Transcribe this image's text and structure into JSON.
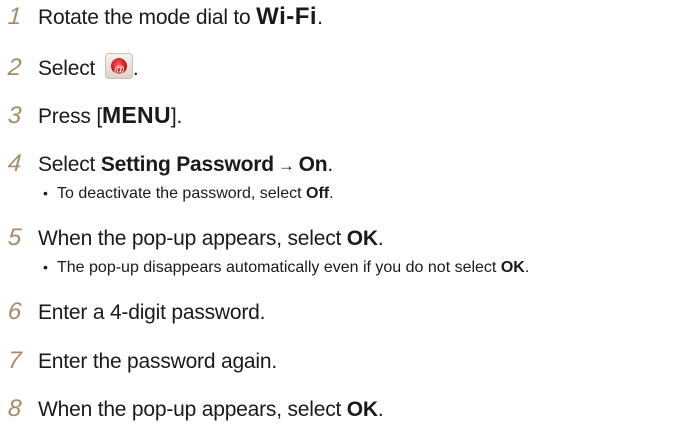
{
  "steps": [
    {
      "num": "1",
      "text": "Rotate the mode dial to ",
      "mode_label": "Wi-Fi",
      "end": "."
    },
    {
      "num": "2",
      "text": "Select ",
      "icon": "wifi-app-icon",
      "end": "."
    },
    {
      "num": "3",
      "text": "Press [",
      "key_label": "MENU",
      "end": "]."
    },
    {
      "num": "4",
      "text": "Select ",
      "bold1": "Setting Password",
      "arrow": "→",
      "bold2": "On",
      "end": "."
    },
    {
      "num": "5",
      "text": "When the pop-up appears, select ",
      "bold": "OK",
      "end": "."
    },
    {
      "num": "6",
      "text": "Enter a 4-digit password."
    },
    {
      "num": "7",
      "text": "Enter the password again."
    },
    {
      "num": "8",
      "text": "When the pop-up appears, select ",
      "bold": "OK",
      "end": "."
    }
  ],
  "subs": [
    {
      "bullet": "•",
      "text": "To deactivate the password, select ",
      "bold": "Off",
      "end": "."
    },
    {
      "bullet": "•",
      "text": "The pop-up disappears automatically even if you do not select ",
      "bold": "OK",
      "end": "."
    }
  ]
}
